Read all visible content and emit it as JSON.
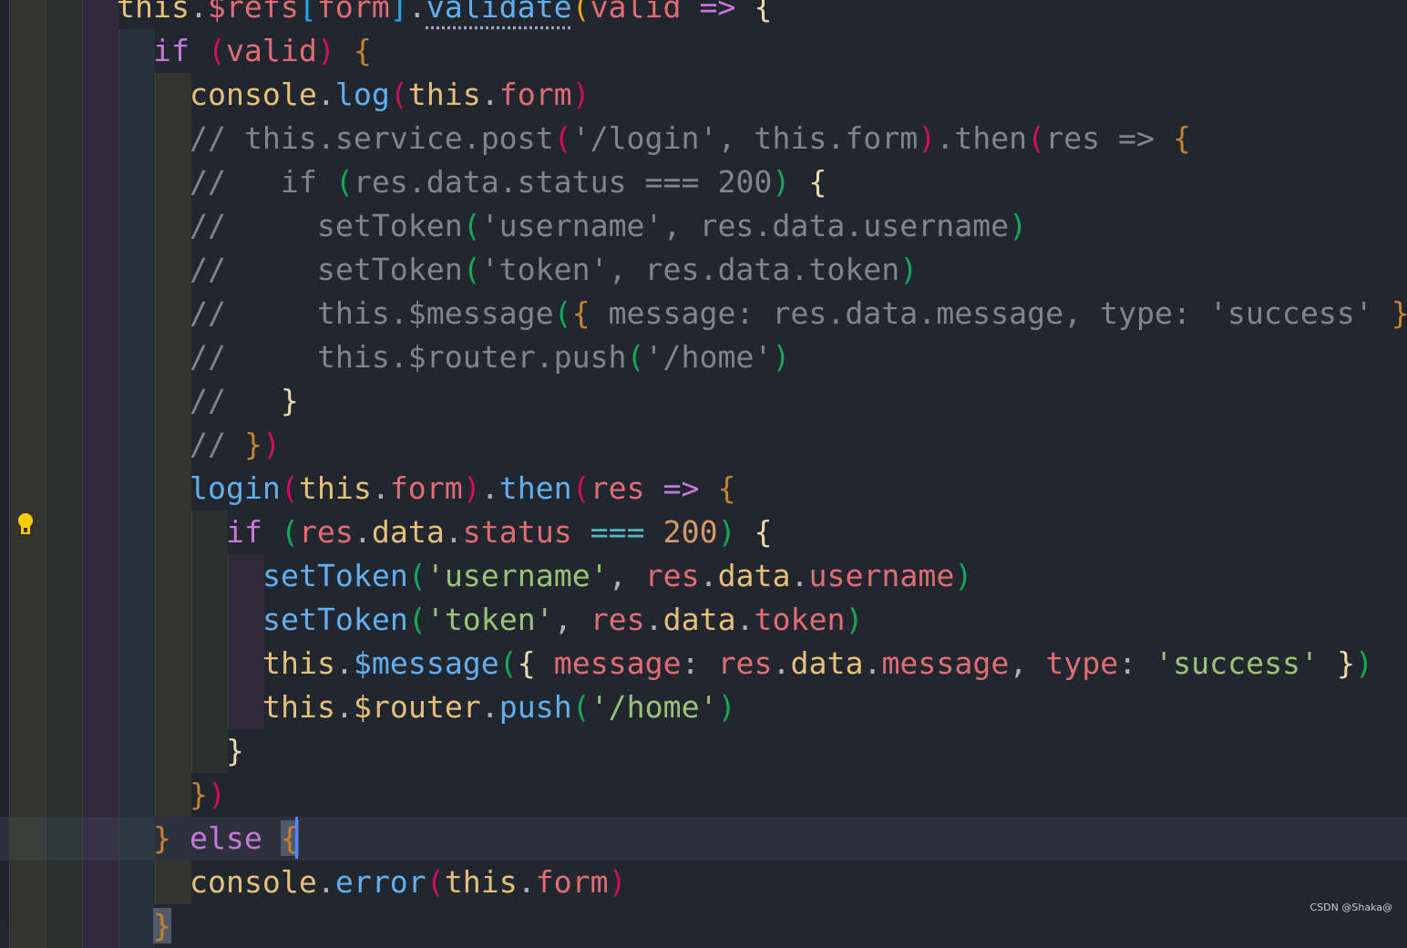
{
  "code": {
    "lines": [
      {
        "indent": 3,
        "tokens": [
          {
            "t": "this",
            "k": "y"
          },
          {
            "t": ".",
            "k": "p"
          },
          {
            "t": "$refs",
            "k": "var"
          },
          {
            "t": "[",
            "k": "sq"
          },
          {
            "t": "form",
            "k": "var"
          },
          {
            "t": "]",
            "k": "sq"
          },
          {
            "t": ".",
            "k": "p"
          },
          {
            "t": "validate",
            "k": "fn dots"
          },
          {
            "t": "(",
            "k": "b5"
          },
          {
            "t": "valid",
            "k": "var"
          },
          {
            "t": " ",
            "k": "p"
          },
          {
            "t": "=>",
            "k": "arrow"
          },
          {
            "t": " ",
            "k": "p"
          },
          {
            "t": "{",
            "k": "b4"
          }
        ]
      },
      {
        "indent": 4,
        "tokens": [
          {
            "t": "if",
            "k": "kw"
          },
          {
            "t": " ",
            "k": "p"
          },
          {
            "t": "(",
            "k": "b1"
          },
          {
            "t": "valid",
            "k": "var"
          },
          {
            "t": ")",
            "k": "b1"
          },
          {
            "t": " ",
            "k": "p"
          },
          {
            "t": "{",
            "k": "b3"
          }
        ]
      },
      {
        "indent": 5,
        "tokens": [
          {
            "t": "console",
            "k": "y"
          },
          {
            "t": ".",
            "k": "p"
          },
          {
            "t": "log",
            "k": "fn"
          },
          {
            "t": "(",
            "k": "b1"
          },
          {
            "t": "this",
            "k": "y"
          },
          {
            "t": ".",
            "k": "p"
          },
          {
            "t": "form",
            "k": "var"
          },
          {
            "t": ")",
            "k": "b1"
          }
        ]
      },
      {
        "indent": 5,
        "tokens": [
          {
            "t": "// this.service.post",
            "k": "cm"
          },
          {
            "t": "(",
            "k": "b1"
          },
          {
            "t": "'/login', this.form",
            "k": "cm"
          },
          {
            "t": ")",
            "k": "b1"
          },
          {
            "t": ".then",
            "k": "cm"
          },
          {
            "t": "(",
            "k": "b1"
          },
          {
            "t": "res => ",
            "k": "cm"
          },
          {
            "t": "{",
            "k": "b3"
          }
        ]
      },
      {
        "indent": 5,
        "tokens": [
          {
            "t": "//   if ",
            "k": "cm"
          },
          {
            "t": "(",
            "k": "b2"
          },
          {
            "t": "res.data.status === 200",
            "k": "cm"
          },
          {
            "t": ")",
            "k": "b2"
          },
          {
            "t": " ",
            "k": "cm"
          },
          {
            "t": "{",
            "k": "b4"
          }
        ]
      },
      {
        "indent": 5,
        "tokens": [
          {
            "t": "//     setToken",
            "k": "cm"
          },
          {
            "t": "(",
            "k": "b2"
          },
          {
            "t": "'username', res.data.username",
            "k": "cm"
          },
          {
            "t": ")",
            "k": "b2"
          }
        ]
      },
      {
        "indent": 5,
        "tokens": [
          {
            "t": "//     setToken",
            "k": "cm"
          },
          {
            "t": "(",
            "k": "b2"
          },
          {
            "t": "'token', res.data.token",
            "k": "cm"
          },
          {
            "t": ")",
            "k": "b2"
          }
        ]
      },
      {
        "indent": 5,
        "tokens": [
          {
            "t": "//     this.$message",
            "k": "cm"
          },
          {
            "t": "(",
            "k": "b2"
          },
          {
            "t": "{",
            "k": "b3"
          },
          {
            "t": " message: res.data.message, type: 'success' ",
            "k": "cm"
          },
          {
            "t": "}",
            "k": "b3"
          },
          {
            "t": ")",
            "k": "b2"
          }
        ]
      },
      {
        "indent": 5,
        "tokens": [
          {
            "t": "//     this.$router.push",
            "k": "cm"
          },
          {
            "t": "(",
            "k": "b2"
          },
          {
            "t": "'/home'",
            "k": "cm"
          },
          {
            "t": ")",
            "k": "b2"
          }
        ]
      },
      {
        "indent": 5,
        "tokens": [
          {
            "t": "//   ",
            "k": "cm"
          },
          {
            "t": "}",
            "k": "b4"
          }
        ]
      },
      {
        "indent": 5,
        "tokens": [
          {
            "t": "// ",
            "k": "cm"
          },
          {
            "t": "}",
            "k": "b3"
          },
          {
            "t": ")",
            "k": "b1"
          }
        ]
      },
      {
        "indent": 5,
        "tokens": [
          {
            "t": "login",
            "k": "fn"
          },
          {
            "t": "(",
            "k": "b1"
          },
          {
            "t": "this",
            "k": "y"
          },
          {
            "t": ".",
            "k": "p"
          },
          {
            "t": "form",
            "k": "var"
          },
          {
            "t": ")",
            "k": "b1"
          },
          {
            "t": ".",
            "k": "p"
          },
          {
            "t": "then",
            "k": "fn"
          },
          {
            "t": "(",
            "k": "b1"
          },
          {
            "t": "res",
            "k": "var"
          },
          {
            "t": " ",
            "k": "p"
          },
          {
            "t": "=>",
            "k": "arrow"
          },
          {
            "t": " ",
            "k": "p"
          },
          {
            "t": "{",
            "k": "b3"
          }
        ]
      },
      {
        "indent": 6,
        "tokens": [
          {
            "t": "if",
            "k": "kw"
          },
          {
            "t": " ",
            "k": "p"
          },
          {
            "t": "(",
            "k": "b2"
          },
          {
            "t": "res",
            "k": "var"
          },
          {
            "t": ".",
            "k": "p"
          },
          {
            "t": "data",
            "k": "y"
          },
          {
            "t": ".",
            "k": "p"
          },
          {
            "t": "status",
            "k": "var"
          },
          {
            "t": " ",
            "k": "p"
          },
          {
            "t": "===",
            "k": "op"
          },
          {
            "t": " ",
            "k": "p"
          },
          {
            "t": "200",
            "k": "num"
          },
          {
            "t": ")",
            "k": "b2"
          },
          {
            "t": " ",
            "k": "p"
          },
          {
            "t": "{",
            "k": "b4"
          }
        ]
      },
      {
        "indent": 7,
        "tokens": [
          {
            "t": "setToken",
            "k": "fn"
          },
          {
            "t": "(",
            "k": "b2"
          },
          {
            "t": "'username'",
            "k": "str"
          },
          {
            "t": ", ",
            "k": "p"
          },
          {
            "t": "res",
            "k": "var"
          },
          {
            "t": ".",
            "k": "p"
          },
          {
            "t": "data",
            "k": "y"
          },
          {
            "t": ".",
            "k": "p"
          },
          {
            "t": "username",
            "k": "var"
          },
          {
            "t": ")",
            "k": "b2"
          }
        ]
      },
      {
        "indent": 7,
        "tokens": [
          {
            "t": "setToken",
            "k": "fn"
          },
          {
            "t": "(",
            "k": "b2"
          },
          {
            "t": "'token'",
            "k": "str"
          },
          {
            "t": ", ",
            "k": "p"
          },
          {
            "t": "res",
            "k": "var"
          },
          {
            "t": ".",
            "k": "p"
          },
          {
            "t": "data",
            "k": "y"
          },
          {
            "t": ".",
            "k": "p"
          },
          {
            "t": "token",
            "k": "var"
          },
          {
            "t": ")",
            "k": "b2"
          }
        ]
      },
      {
        "indent": 7,
        "tokens": [
          {
            "t": "this",
            "k": "y"
          },
          {
            "t": ".",
            "k": "p"
          },
          {
            "t": "$message",
            "k": "fn"
          },
          {
            "t": "(",
            "k": "b2"
          },
          {
            "t": "{",
            "k": "b4"
          },
          {
            "t": " ",
            "k": "p"
          },
          {
            "t": "message",
            "k": "var"
          },
          {
            "t": ": ",
            "k": "p"
          },
          {
            "t": "res",
            "k": "var"
          },
          {
            "t": ".",
            "k": "p"
          },
          {
            "t": "data",
            "k": "y"
          },
          {
            "t": ".",
            "k": "p"
          },
          {
            "t": "message",
            "k": "var"
          },
          {
            "t": ", ",
            "k": "p"
          },
          {
            "t": "type",
            "k": "var"
          },
          {
            "t": ": ",
            "k": "p"
          },
          {
            "t": "'success'",
            "k": "str"
          },
          {
            "t": " ",
            "k": "p"
          },
          {
            "t": "}",
            "k": "b4"
          },
          {
            "t": ")",
            "k": "b2"
          }
        ]
      },
      {
        "indent": 7,
        "tokens": [
          {
            "t": "this",
            "k": "y"
          },
          {
            "t": ".",
            "k": "p"
          },
          {
            "t": "$router",
            "k": "y"
          },
          {
            "t": ".",
            "k": "p"
          },
          {
            "t": "push",
            "k": "fn"
          },
          {
            "t": "(",
            "k": "b2"
          },
          {
            "t": "'/home'",
            "k": "str"
          },
          {
            "t": ")",
            "k": "b2"
          }
        ]
      },
      {
        "indent": 6,
        "tokens": [
          {
            "t": "}",
            "k": "b4"
          }
        ]
      },
      {
        "indent": 5,
        "tokens": [
          {
            "t": "}",
            "k": "b3"
          },
          {
            "t": ")",
            "k": "b1"
          }
        ]
      },
      {
        "indent": 4,
        "active": true,
        "tokens": [
          {
            "t": "}",
            "k": "b3"
          },
          {
            "t": " ",
            "k": "p"
          },
          {
            "t": "else",
            "k": "kw"
          },
          {
            "t": " ",
            "k": "p"
          },
          {
            "t": "{",
            "k": "b3 match"
          }
        ]
      },
      {
        "indent": 5,
        "tokens": [
          {
            "t": "console",
            "k": "y"
          },
          {
            "t": ".",
            "k": "p"
          },
          {
            "t": "error",
            "k": "fn"
          },
          {
            "t": "(",
            "k": "b1"
          },
          {
            "t": "this",
            "k": "y"
          },
          {
            "t": ".",
            "k": "p"
          },
          {
            "t": "form",
            "k": "var"
          },
          {
            "t": ")",
            "k": "b1"
          }
        ]
      },
      {
        "indent": 4,
        "tokens": [
          {
            "t": "}",
            "k": "b3 match"
          }
        ]
      }
    ]
  },
  "gutter": {
    "lightbulb_icon": "lightbulb-icon",
    "lightbulb_color": "#ffcc00"
  },
  "cursor_color": "#528bff",
  "watermark": "CSDN @Shaka@"
}
